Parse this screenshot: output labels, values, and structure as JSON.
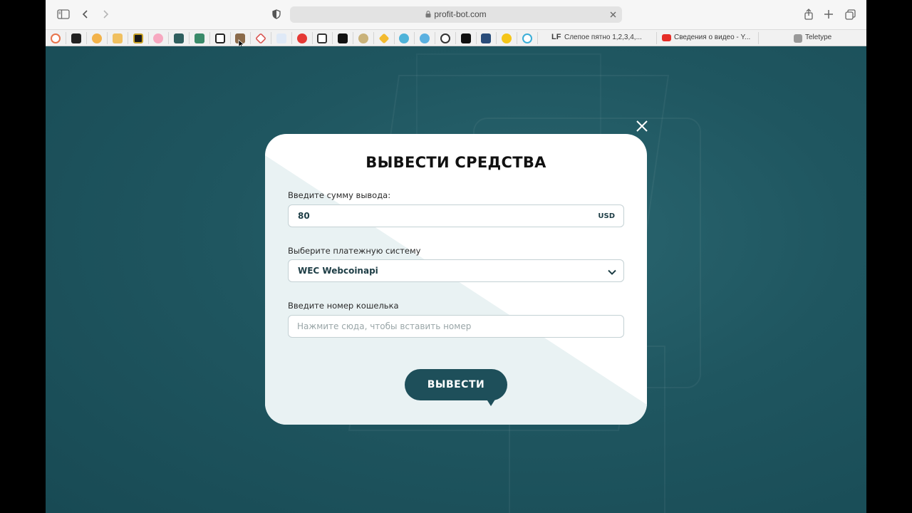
{
  "browser": {
    "url": "profit-bot.com",
    "bookmarks": {
      "text_items": [
        {
          "label": "Слепое пятно 1,2,3,4,...",
          "icon_text": "LF"
        },
        {
          "label": "Сведения о видео - Y..."
        },
        {
          "label": "Teletype"
        }
      ]
    }
  },
  "modal": {
    "title": "ВЫВЕСТИ СРЕДСТВА",
    "amount": {
      "label": "Введите сумму вывода:",
      "value": "80",
      "currency": "USD"
    },
    "payment": {
      "label": "Выберите платежную систему",
      "selected": "WEC Webcoinapi"
    },
    "wallet": {
      "label": "Введите номер кошелька",
      "placeholder": "Нажмите сюда, чтобы вставить номер"
    },
    "submit_label": "ВЫВЕСТИ"
  },
  "colors": {
    "background": "#1c4d57",
    "button": "#1e4f5a",
    "modal": "#ffffff"
  }
}
